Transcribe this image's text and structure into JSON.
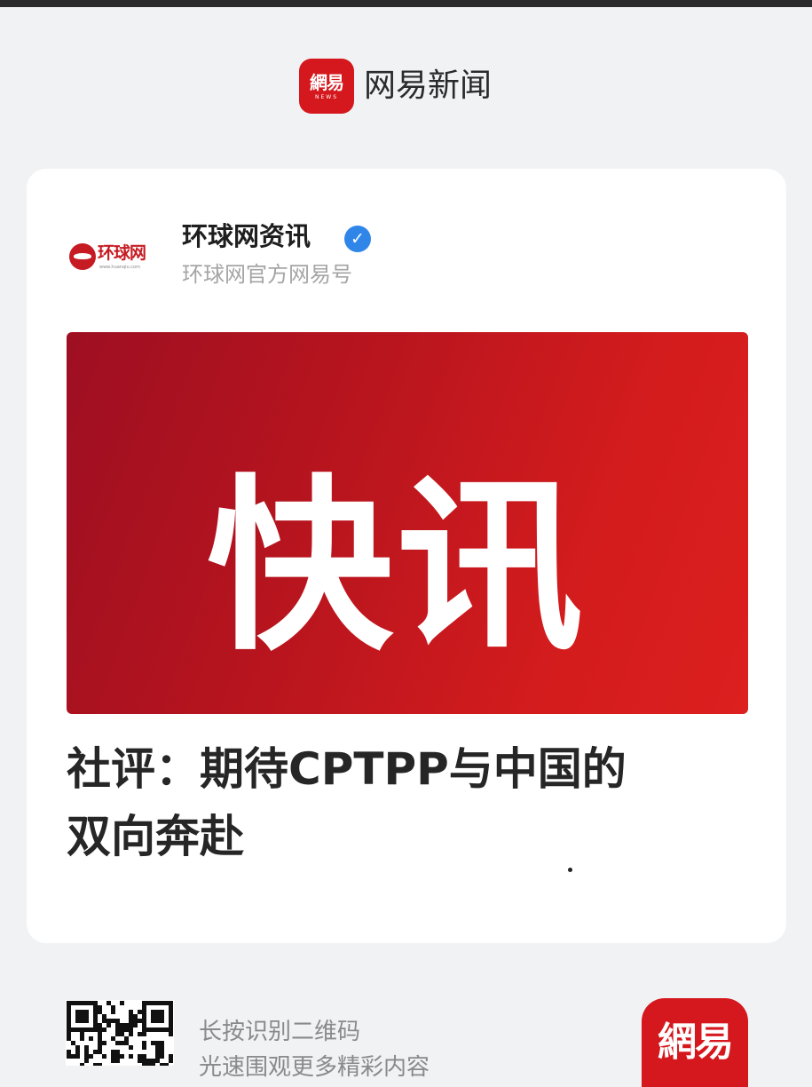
{
  "header": {
    "logo_text": "網易",
    "logo_sub": "NEWS",
    "app_name": "网易新闻"
  },
  "source": {
    "logo_text": "环球网",
    "logo_url": "www.huanqiu.com",
    "name": "环球网资讯",
    "subtitle": "环球网官方网易号"
  },
  "banner": {
    "text": "快讯"
  },
  "article": {
    "title_line1": "社评：期待CPTPP与中国的",
    "title_line2": "双向奔赴"
  },
  "footer": {
    "hint_line1": "长按识别二维码",
    "hint_line2": "光速围观更多精彩内容",
    "logo_text": "網易"
  },
  "colors": {
    "brand_red": "#d5181d",
    "verified_blue": "#2f86e8"
  },
  "icons": [
    "netease-news-logo",
    "huanqiu-logo",
    "verified-icon",
    "qr-code"
  ]
}
